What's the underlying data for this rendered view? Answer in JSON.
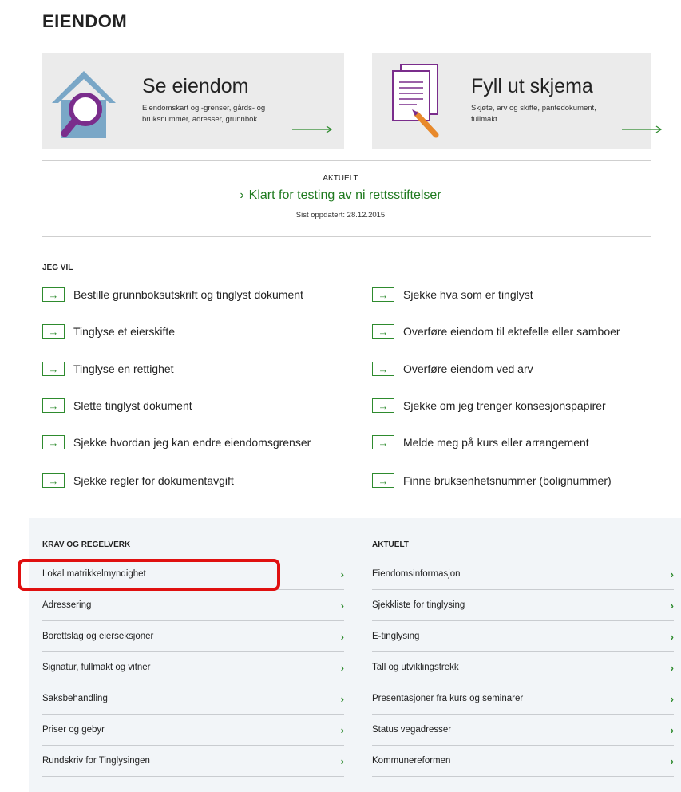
{
  "page": {
    "title": "EIENDOM"
  },
  "cards": [
    {
      "title": "Se eiendom",
      "desc": [
        "Eiendomskart og -grenser, gårds- og",
        "bruksnummer, adresser, grunnbok"
      ],
      "icon": "house-magnifier-icon"
    },
    {
      "title": "Fyll ut skjema",
      "desc": [
        "Skjøte, arv og skifte, pantedokument,",
        "fullmakt"
      ],
      "icon": "document-pen-icon"
    }
  ],
  "news": {
    "label": "AKTUELT",
    "chevron": "›",
    "link": "Klart for testing av ni rettsstiftelser",
    "date": "Sist oppdatert: 28.12.2015"
  },
  "jeg_vil": {
    "label": "JEG VIL",
    "arrow_glyph": "→",
    "left": [
      "Bestille grunnboksutskrift og tinglyst dokument",
      "Tinglyse et eierskifte",
      "Tinglyse en rettighet",
      "Slette tinglyst dokument",
      "Sjekke hvordan jeg kan endre eiendomsgrenser",
      "Sjekke regler for dokumentavgift"
    ],
    "right": [
      "Sjekke hva som er tinglyst",
      "Overføre eiendom til ektefelle eller samboer",
      "Overføre eiendom ved arv",
      "Sjekke om jeg trenger konsesjonspapirer",
      "Melde meg på kurs eller arrangement",
      "Finne bruksenhetsnummer (bolignummer)"
    ]
  },
  "krav": {
    "label": "KRAV OG REGELVERK",
    "chevron": "›",
    "items": [
      "Lokal matrikkelmyndighet",
      "Adressering",
      "Borettslag og eierseksjoner",
      "Signatur, fullmakt og vitner",
      "Saksbehandling",
      "Priser og gebyr",
      "Rundskriv for Tinglysingen"
    ]
  },
  "aktuelt": {
    "label": "AKTUELT",
    "chevron": "›",
    "items": [
      "Eiendomsinformasjon",
      "Sjekkliste for tinglysing",
      "E-tinglysing",
      "Tall og utviklingstrekk",
      "Presentasjoner fra kurs og seminarer",
      "Status vegadresser",
      "Kommunereformen"
    ]
  },
  "colors": {
    "accent_green": "#2e8b2e",
    "link_green": "#1f7a1f",
    "highlight_red": "#e01010"
  }
}
